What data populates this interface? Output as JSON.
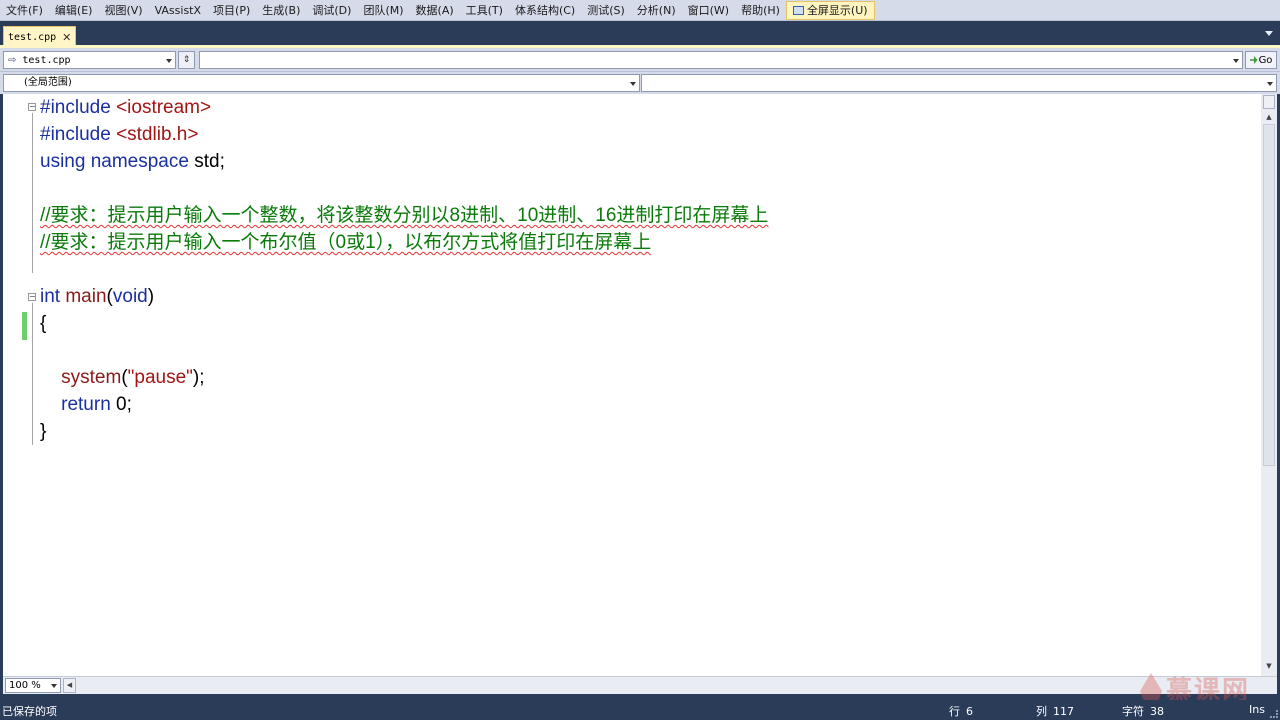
{
  "menu": {
    "items": [
      "文件(F)",
      "编辑(E)",
      "视图(V)",
      "VAssistX",
      "项目(P)",
      "生成(B)",
      "调试(D)",
      "团队(M)",
      "数据(A)",
      "工具(T)",
      "体系结构(C)",
      "测试(S)",
      "分析(N)",
      "窗口(W)",
      "帮助(H)"
    ],
    "fullscreen_label": "全屏显示(U)"
  },
  "tabs": {
    "active_file": "test.cpp",
    "close_glyph": "✕"
  },
  "nav": {
    "file_combo": "test.cpp",
    "go_label": "Go",
    "scope": "(全局范围)"
  },
  "editor": {
    "lines": [
      {
        "id": "l1",
        "parts": [
          {
            "t": "#include ",
            "c": "kw"
          },
          {
            "t": "<iostream>",
            "c": "str"
          }
        ]
      },
      {
        "id": "l2",
        "parts": [
          {
            "t": "#include ",
            "c": "kw"
          },
          {
            "t": "<stdlib.h>",
            "c": "str"
          }
        ]
      },
      {
        "id": "l3",
        "parts": [
          {
            "t": "using namespace ",
            "c": "kw"
          },
          {
            "t": "std;",
            "c": ""
          }
        ]
      },
      {
        "id": "l4",
        "parts": []
      },
      {
        "id": "l5",
        "parts": [
          {
            "t": "//要求：提示用户输入一个整数，将该整数分别以8进制、10进制、16进制打印在屏幕上",
            "c": "cmt"
          }
        ]
      },
      {
        "id": "l6",
        "parts": [
          {
            "t": "//要求：提示用户输入一个布尔值（0或1），以布尔方式将值打印在屏幕上",
            "c": "cmt"
          }
        ]
      },
      {
        "id": "l7",
        "parts": []
      },
      {
        "id": "l8",
        "parts": [
          {
            "t": "int ",
            "c": "kw"
          },
          {
            "t": "main",
            "c": "fn"
          },
          {
            "t": "(",
            "c": ""
          },
          {
            "t": "void",
            "c": "kw"
          },
          {
            "t": ")",
            "c": ""
          }
        ]
      },
      {
        "id": "l9",
        "parts": [
          {
            "t": "{",
            "c": ""
          }
        ]
      },
      {
        "id": "l10",
        "parts": []
      },
      {
        "id": "l11",
        "parts": [
          {
            "t": "    ",
            "c": ""
          },
          {
            "t": "system",
            "c": "fn"
          },
          {
            "t": "(",
            "c": ""
          },
          {
            "t": "\"pause\"",
            "c": "str"
          },
          {
            "t": ");",
            "c": ""
          }
        ]
      },
      {
        "id": "l12",
        "parts": [
          {
            "t": "    ",
            "c": ""
          },
          {
            "t": "return ",
            "c": "kw"
          },
          {
            "t": "0;",
            "c": ""
          }
        ]
      },
      {
        "id": "l13",
        "parts": [
          {
            "t": "}",
            "c": ""
          }
        ]
      }
    ]
  },
  "zoom": "100 %",
  "status": {
    "message": "已保存的项",
    "line_label": "行",
    "line_value": "6",
    "col_label": "列",
    "col_value": "117",
    "char_label": "字符",
    "char_value": "38",
    "mode": "Ins"
  },
  "watermark": "慕课网"
}
